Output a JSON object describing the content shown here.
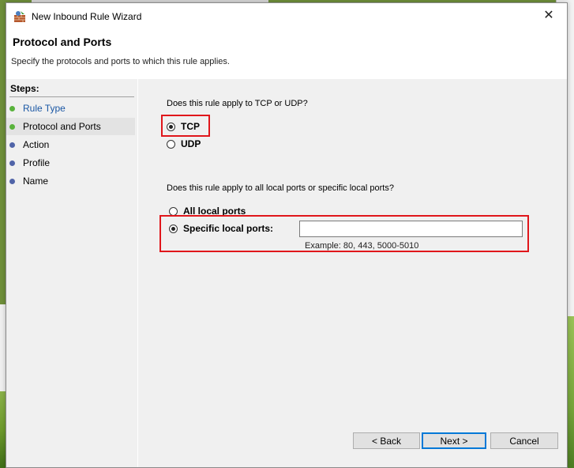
{
  "window": {
    "title": "New Inbound Rule Wizard",
    "close_glyph": "✕"
  },
  "header": {
    "title": "Protocol and Ports",
    "subtitle": "Specify the protocols and ports to which this rule applies."
  },
  "steps": {
    "label": "Steps:",
    "items": [
      {
        "label": "Rule Type",
        "state": "done"
      },
      {
        "label": "Protocol and Ports",
        "state": "active"
      },
      {
        "label": "Action",
        "state": "pending"
      },
      {
        "label": "Profile",
        "state": "pending"
      },
      {
        "label": "Name",
        "state": "pending"
      }
    ]
  },
  "protocol": {
    "question": "Does this rule apply to TCP or UDP?",
    "options": [
      "TCP",
      "UDP"
    ],
    "selected": "TCP"
  },
  "ports": {
    "question": "Does this rule apply to all local ports or specific local ports?",
    "options": [
      "All local ports",
      "Specific local ports:"
    ],
    "selected": "Specific local ports:",
    "input_value": "",
    "example": "Example: 80, 443, 5000-5010"
  },
  "buttons": {
    "back": "< Back",
    "next": "Next >",
    "cancel": "Cancel"
  },
  "colors": {
    "highlight": "#e0161b",
    "step_done": "#59b33c",
    "step_pending": "#5064a8",
    "link": "#1a57a4"
  }
}
